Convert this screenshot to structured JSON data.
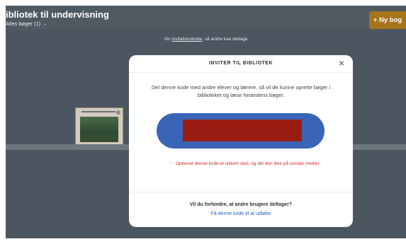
{
  "header": {
    "title": "ibliotek til undervisning",
    "subtitle": "Alles bøger (1)",
    "new_book_button": "+ Ny bog"
  },
  "banner": {
    "prefix": "Vis ",
    "link": "invitationskode",
    "suffix": ", så andre kan deltage"
  },
  "modal": {
    "title": "INVITER TIL BIBLIOTEK",
    "close": "×",
    "description": "Del denne kode med andre elever og lærere, så vil de kunne oprette bøger i biblioteket og læse hinandens bøger.",
    "warning": "Opbevar denne kode et sikkert sted, og del den ikke på sociale medier.",
    "footer_question": "Vil du forhindre, at andre brugere deltager?",
    "footer_link": "Få denne kode til at udløbe"
  },
  "colors": {
    "background": "#4b5661",
    "code_pill": "#3a65b7",
    "redacted": "#9a1d14",
    "warning": "#d42d2a",
    "link": "#2a63bf",
    "button": "#a7731b"
  }
}
